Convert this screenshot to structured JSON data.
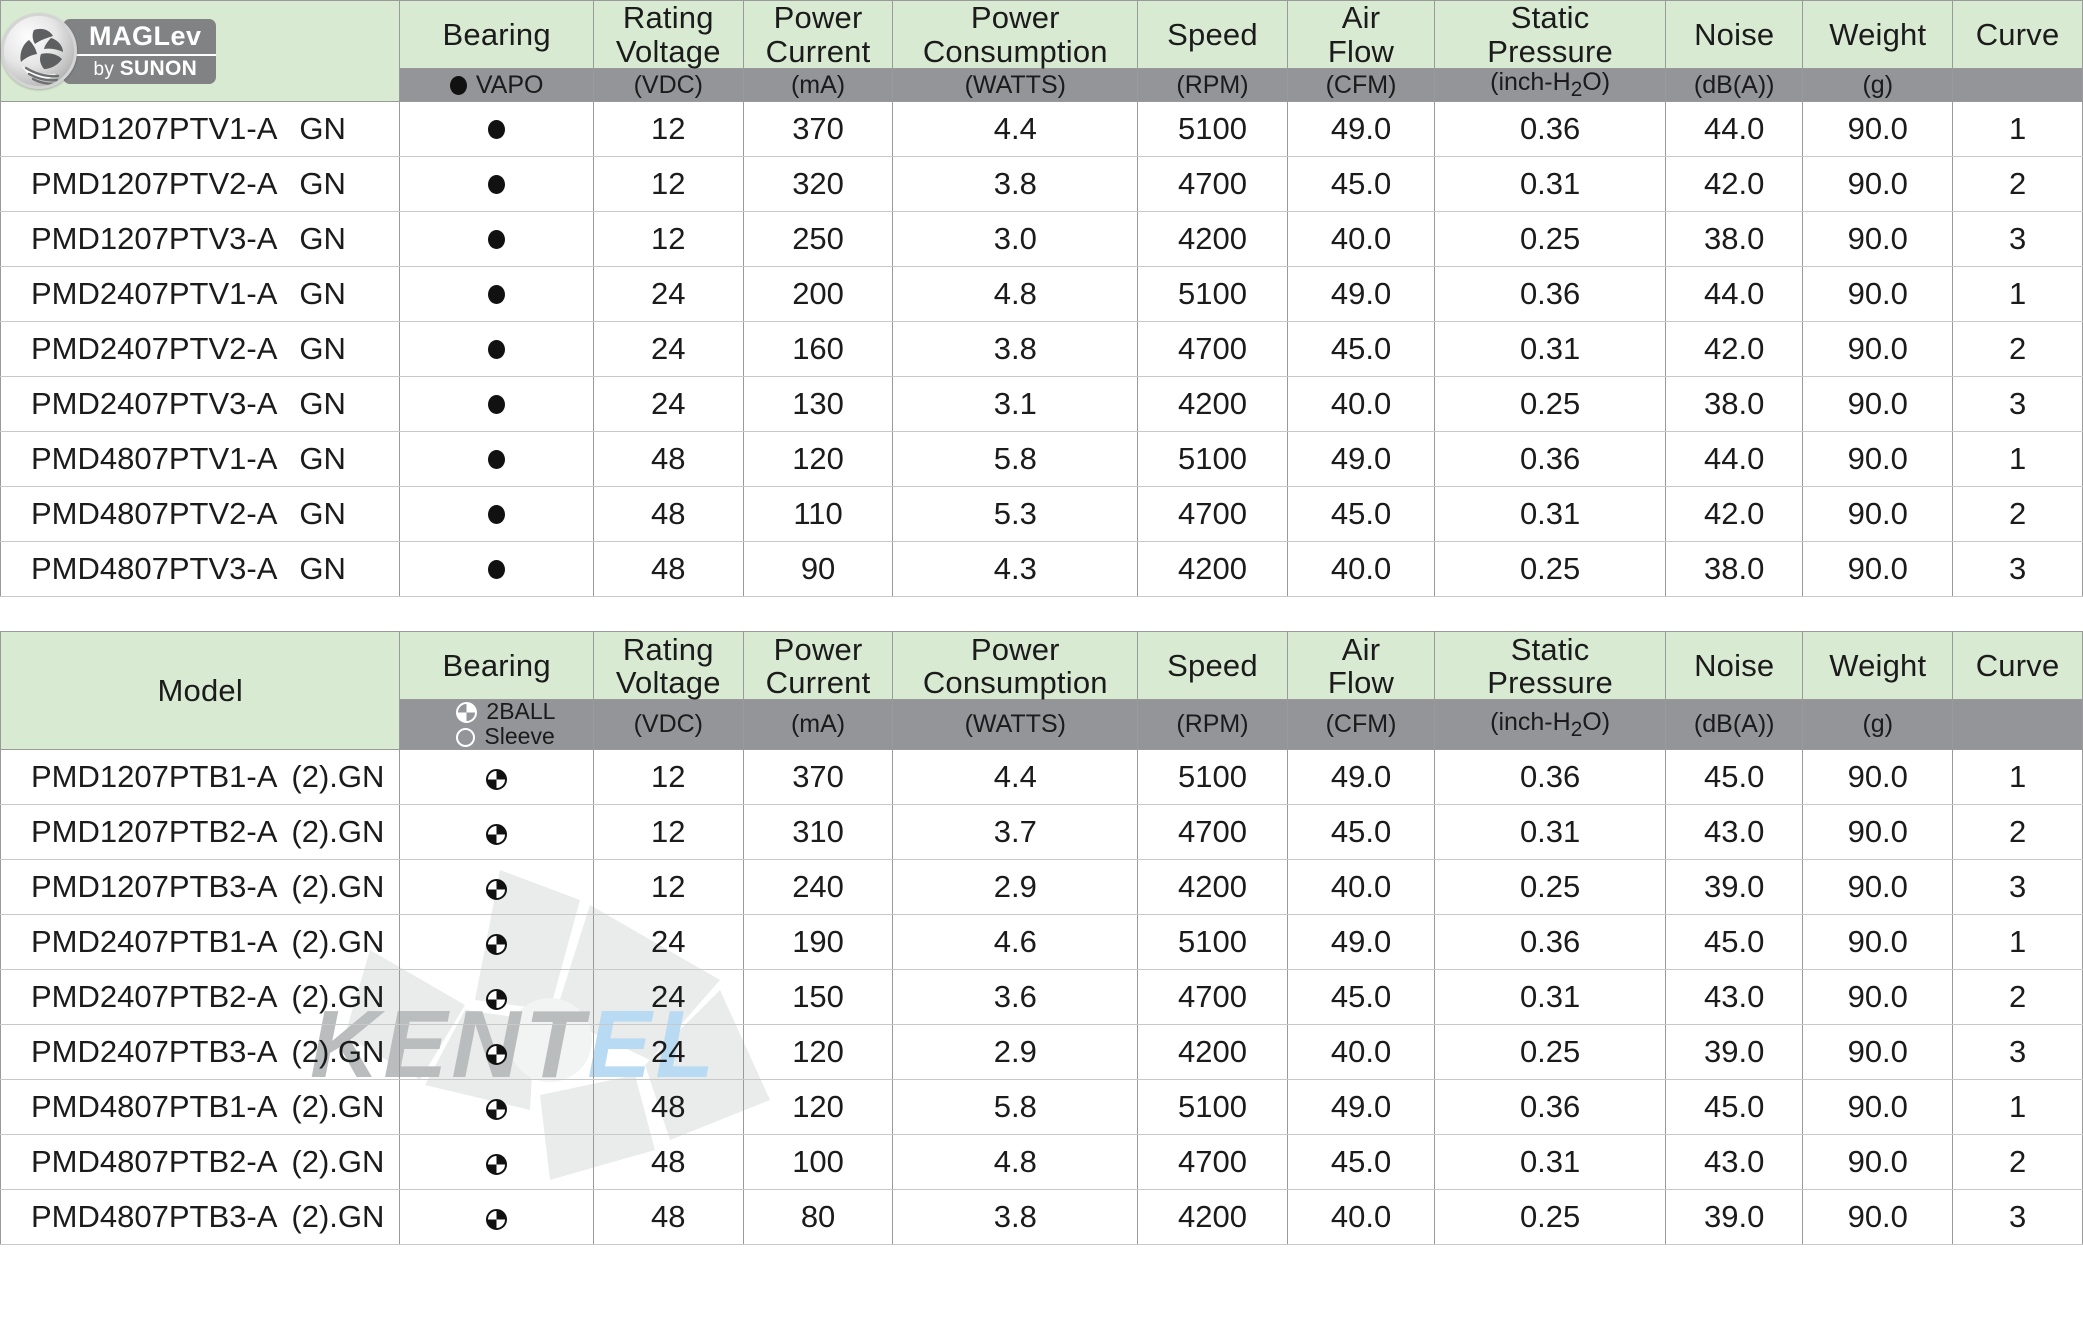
{
  "brand": {
    "logo_name": "MAGLev by SUNON",
    "wordmark_top": "MAGLev",
    "wordmark_bottom_prefix": "by ",
    "wordmark_bottom_name": "SUNON"
  },
  "watermark": {
    "text_1": "K",
    "text_2": "E",
    "text_3": "N",
    "text_4": "T",
    "text_5": "E",
    "text_6": "L"
  },
  "columns": {
    "model": "Model",
    "bearing": "Bearing",
    "rating_voltage": "Rating\nVoltage",
    "rating_voltage_l1": "Rating",
    "rating_voltage_l2": "Voltage",
    "power_current_l1": "Power",
    "power_current_l2": "Current",
    "power_consumption_l1": "Power",
    "power_consumption_l2": "Consumption",
    "speed": "Speed",
    "air_flow_l1": "Air",
    "air_flow_l2": "Flow",
    "static_pressure_l1": "Static",
    "static_pressure_l2": "Pressure",
    "noise": "Noise",
    "weight": "Weight",
    "curve": "Curve"
  },
  "units": {
    "vapo": "VAPO",
    "twoball": "2BALL",
    "sleeve": "Sleeve",
    "voltage": "(VDC)",
    "current": "(mA)",
    "consumption": "(WATTS)",
    "speed": "(RPM)",
    "air_flow": "(CFM)",
    "static_pressure_pre": "(inch-H",
    "static_pressure_sub": "2",
    "static_pressure_post": "O)",
    "noise": "(dB(A))",
    "weight": "(g)",
    "curve": ""
  },
  "table1": {
    "bearing_type": "vapo",
    "rows": [
      {
        "model": "PMD1207PTV1-A",
        "suffix": "GN",
        "bearing": "vapo",
        "voltage": "12",
        "current": "370",
        "consumption": "4.4",
        "speed": "5100",
        "air_flow": "49.0",
        "static_pressure": "0.36",
        "noise": "44.0",
        "weight": "90.0",
        "curve": "1"
      },
      {
        "model": "PMD1207PTV2-A",
        "suffix": "GN",
        "bearing": "vapo",
        "voltage": "12",
        "current": "320",
        "consumption": "3.8",
        "speed": "4700",
        "air_flow": "45.0",
        "static_pressure": "0.31",
        "noise": "42.0",
        "weight": "90.0",
        "curve": "2"
      },
      {
        "model": "PMD1207PTV3-A",
        "suffix": "GN",
        "bearing": "vapo",
        "voltage": "12",
        "current": "250",
        "consumption": "3.0",
        "speed": "4200",
        "air_flow": "40.0",
        "static_pressure": "0.25",
        "noise": "38.0",
        "weight": "90.0",
        "curve": "3"
      },
      {
        "model": "PMD2407PTV1-A",
        "suffix": "GN",
        "bearing": "vapo",
        "voltage": "24",
        "current": "200",
        "consumption": "4.8",
        "speed": "5100",
        "air_flow": "49.0",
        "static_pressure": "0.36",
        "noise": "44.0",
        "weight": "90.0",
        "curve": "1"
      },
      {
        "model": "PMD2407PTV2-A",
        "suffix": "GN",
        "bearing": "vapo",
        "voltage": "24",
        "current": "160",
        "consumption": "3.8",
        "speed": "4700",
        "air_flow": "45.0",
        "static_pressure": "0.31",
        "noise": "42.0",
        "weight": "90.0",
        "curve": "2"
      },
      {
        "model": "PMD2407PTV3-A",
        "suffix": "GN",
        "bearing": "vapo",
        "voltage": "24",
        "current": "130",
        "consumption": "3.1",
        "speed": "4200",
        "air_flow": "40.0",
        "static_pressure": "0.25",
        "noise": "38.0",
        "weight": "90.0",
        "curve": "3"
      },
      {
        "model": "PMD4807PTV1-A",
        "suffix": "GN",
        "bearing": "vapo",
        "voltage": "48",
        "current": "120",
        "consumption": "5.8",
        "speed": "5100",
        "air_flow": "49.0",
        "static_pressure": "0.36",
        "noise": "44.0",
        "weight": "90.0",
        "curve": "1"
      },
      {
        "model": "PMD4807PTV2-A",
        "suffix": "GN",
        "bearing": "vapo",
        "voltage": "48",
        "current": "110",
        "consumption": "5.3",
        "speed": "4700",
        "air_flow": "45.0",
        "static_pressure": "0.31",
        "noise": "42.0",
        "weight": "90.0",
        "curve": "2"
      },
      {
        "model": "PMD4807PTV3-A",
        "suffix": "GN",
        "bearing": "vapo",
        "voltage": "48",
        "current": "90",
        "consumption": "4.3",
        "speed": "4200",
        "air_flow": "40.0",
        "static_pressure": "0.25",
        "noise": "38.0",
        "weight": "90.0",
        "curve": "3"
      }
    ]
  },
  "table2": {
    "bearing_type": "2ball",
    "rows": [
      {
        "model": "PMD1207PTB1-A",
        "suffix": "(2).GN",
        "bearing": "2ball",
        "voltage": "12",
        "current": "370",
        "consumption": "4.4",
        "speed": "5100",
        "air_flow": "49.0",
        "static_pressure": "0.36",
        "noise": "45.0",
        "weight": "90.0",
        "curve": "1"
      },
      {
        "model": "PMD1207PTB2-A",
        "suffix": "(2).GN",
        "bearing": "2ball",
        "voltage": "12",
        "current": "310",
        "consumption": "3.7",
        "speed": "4700",
        "air_flow": "45.0",
        "static_pressure": "0.31",
        "noise": "43.0",
        "weight": "90.0",
        "curve": "2"
      },
      {
        "model": "PMD1207PTB3-A",
        "suffix": "(2).GN",
        "bearing": "2ball",
        "voltage": "12",
        "current": "240",
        "consumption": "2.9",
        "speed": "4200",
        "air_flow": "40.0",
        "static_pressure": "0.25",
        "noise": "39.0",
        "weight": "90.0",
        "curve": "3"
      },
      {
        "model": "PMD2407PTB1-A",
        "suffix": "(2).GN",
        "bearing": "2ball",
        "voltage": "24",
        "current": "190",
        "consumption": "4.6",
        "speed": "5100",
        "air_flow": "49.0",
        "static_pressure": "0.36",
        "noise": "45.0",
        "weight": "90.0",
        "curve": "1"
      },
      {
        "model": "PMD2407PTB2-A",
        "suffix": "(2).GN",
        "bearing": "2ball",
        "voltage": "24",
        "current": "150",
        "consumption": "3.6",
        "speed": "4700",
        "air_flow": "45.0",
        "static_pressure": "0.31",
        "noise": "43.0",
        "weight": "90.0",
        "curve": "2"
      },
      {
        "model": "PMD2407PTB3-A",
        "suffix": "(2).GN",
        "bearing": "2ball",
        "voltage": "24",
        "current": "120",
        "consumption": "2.9",
        "speed": "4200",
        "air_flow": "40.0",
        "static_pressure": "0.25",
        "noise": "39.0",
        "weight": "90.0",
        "curve": "3"
      },
      {
        "model": "PMD4807PTB1-A",
        "suffix": "(2).GN",
        "bearing": "2ball",
        "voltage": "48",
        "current": "120",
        "consumption": "5.8",
        "speed": "5100",
        "air_flow": "49.0",
        "static_pressure": "0.36",
        "noise": "45.0",
        "weight": "90.0",
        "curve": "1"
      },
      {
        "model": "PMD4807PTB2-A",
        "suffix": "(2).GN",
        "bearing": "2ball",
        "voltage": "48",
        "current": "100",
        "consumption": "4.8",
        "speed": "4700",
        "air_flow": "45.0",
        "static_pressure": "0.31",
        "noise": "43.0",
        "weight": "90.0",
        "curve": "2"
      },
      {
        "model": "PMD4807PTB3-A",
        "suffix": "(2).GN",
        "bearing": "2ball",
        "voltage": "48",
        "current": "80",
        "consumption": "3.8",
        "speed": "4200",
        "air_flow": "40.0",
        "static_pressure": "0.25",
        "noise": "39.0",
        "weight": "90.0",
        "curve": "3"
      }
    ]
  },
  "colors": {
    "header_green": "#d9ead3",
    "unit_gray": "#939598",
    "border_gray": "#9a9a9a",
    "text": "#1b1b1b"
  }
}
